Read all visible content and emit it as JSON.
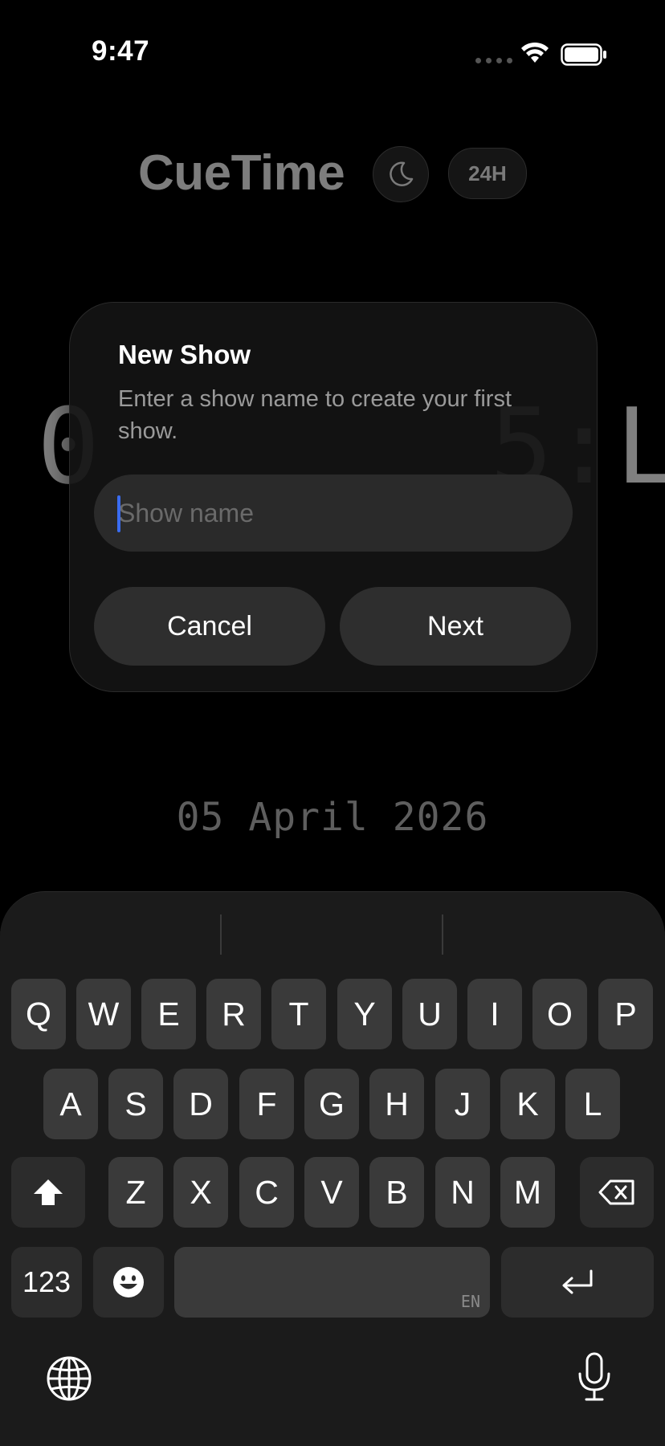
{
  "status_bar": {
    "time": "9:47",
    "icons": [
      "signal-dots-icon",
      "wifi-icon",
      "battery-icon"
    ]
  },
  "header": {
    "title": "CueTime",
    "theme_toggle_icon": "moon-icon",
    "clock_format_label": "24H"
  },
  "background_clock": {
    "left_fragment": "0",
    "right_fragment": "5:L"
  },
  "date_display": "05 April 2026",
  "dialog": {
    "title": "New Show",
    "message": "Enter a show name to create your first show.",
    "input": {
      "value": "",
      "placeholder": "Show name"
    },
    "cancel_label": "Cancel",
    "next_label": "Next",
    "accent_color": "#3a6cf0"
  },
  "keyboard": {
    "row1": [
      "Q",
      "W",
      "E",
      "R",
      "T",
      "Y",
      "U",
      "I",
      "O",
      "P"
    ],
    "row2": [
      "A",
      "S",
      "D",
      "F",
      "G",
      "H",
      "J",
      "K",
      "L"
    ],
    "row3": [
      "Z",
      "X",
      "C",
      "V",
      "B",
      "N",
      "M"
    ],
    "numbers_label": "123",
    "space_language": "EN",
    "icons": {
      "shift": "shift-icon",
      "delete": "backspace-icon",
      "emoji": "emoji-icon",
      "return": "return-icon",
      "globe": "globe-icon",
      "mic": "microphone-icon"
    }
  }
}
